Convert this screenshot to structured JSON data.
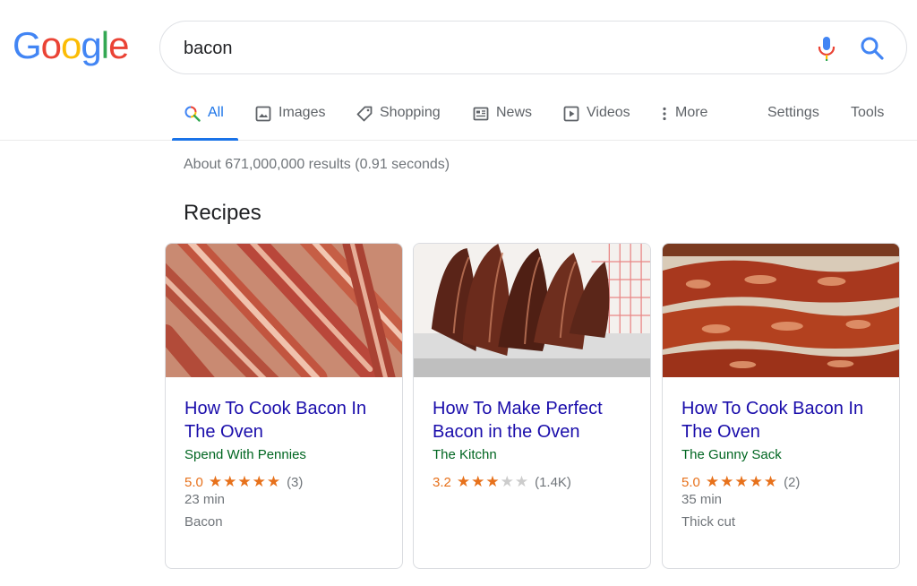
{
  "logo": {
    "letters": [
      "G",
      "o",
      "o",
      "g",
      "l",
      "e"
    ],
    "colors": [
      "#4285F4",
      "#EA4335",
      "#FBBC05",
      "#4285F4",
      "#34A853",
      "#EA4335"
    ]
  },
  "search": {
    "value": "bacon"
  },
  "tabs": [
    {
      "label": "All",
      "icon": "search-multicolor-icon",
      "active": true
    },
    {
      "label": "Images",
      "icon": "image-icon"
    },
    {
      "label": "Shopping",
      "icon": "tag-icon"
    },
    {
      "label": "News",
      "icon": "newspaper-icon"
    },
    {
      "label": "Videos",
      "icon": "play-icon"
    },
    {
      "label": "More",
      "icon": "more-vert-icon"
    }
  ],
  "tools": {
    "settings": "Settings",
    "tools": "Tools"
  },
  "stats": "About 671,000,000 results (0.91 seconds)",
  "recipes": {
    "heading": "Recipes",
    "cards": [
      {
        "title": "How To Cook Bacon In The Oven",
        "source": "Spend With Pennies",
        "rating": "5.0",
        "stars": 5,
        "count": "(3)",
        "time": "23 min",
        "ingredient": "Bacon"
      },
      {
        "title": "How To Make Perfect Bacon in the Oven",
        "source": "The Kitchn",
        "rating": "3.2",
        "stars": 3,
        "count": "(1.4K)",
        "time": "",
        "ingredient": ""
      },
      {
        "title": "How To Cook Bacon In The Oven",
        "source": "The Gunny Sack",
        "rating": "5.0",
        "stars": 5,
        "count": "(2)",
        "time": "35 min",
        "ingredient": "Thick cut"
      }
    ]
  },
  "colors": {
    "link": "#1a0dab",
    "source": "#006621",
    "star": "#e7711b",
    "accent": "#1a73e8"
  }
}
